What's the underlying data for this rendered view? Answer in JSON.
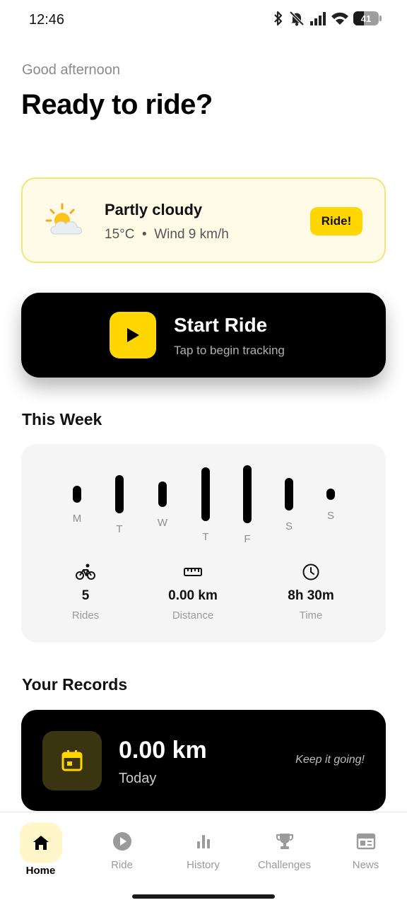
{
  "status_bar": {
    "time": "12:46",
    "battery": "41"
  },
  "header": {
    "greeting": "Good afternoon",
    "headline": "Ready to ride?"
  },
  "weather": {
    "condition": "Partly cloudy",
    "temperature": "15°C",
    "separator": "•",
    "wind": "Wind 9 km/h",
    "cta": "Ride!",
    "icon": "partly-cloudy-icon"
  },
  "start_ride": {
    "title": "Start Ride",
    "subtitle": "Tap to begin tracking",
    "icon": "play-icon"
  },
  "this_week": {
    "title": "This Week",
    "days": [
      {
        "label": "M",
        "level": 0.3
      },
      {
        "label": "T",
        "level": 0.67
      },
      {
        "label": "W",
        "level": 0.43
      },
      {
        "label": "T",
        "level": 0.92
      },
      {
        "label": "F",
        "level": 1.0
      },
      {
        "label": "S",
        "level": 0.57
      },
      {
        "label": "S",
        "level": 0.2
      }
    ],
    "stats": [
      {
        "icon": "bicycle-icon",
        "value": "5",
        "label": "Rides"
      },
      {
        "icon": "ruler-icon",
        "value": "0.00 km",
        "label": "Distance"
      },
      {
        "icon": "clock-icon",
        "value": "8h 30m",
        "label": "Time"
      }
    ]
  },
  "records": {
    "title": "Your Records",
    "value": "0.00 km",
    "label": "Today",
    "note": "Keep it going!",
    "icon": "calendar-icon"
  },
  "nav": {
    "items": [
      {
        "label": "Home",
        "icon": "home-icon",
        "active": true
      },
      {
        "label": "Ride",
        "icon": "play-circle-icon"
      },
      {
        "label": "History",
        "icon": "bar-chart-icon"
      },
      {
        "label": "Challenges",
        "icon": "trophy-icon"
      },
      {
        "label": "News",
        "icon": "newspaper-icon"
      }
    ]
  },
  "colors": {
    "accent": "#FFD600",
    "card_dark": "#000000",
    "muted": "#8E8E8E"
  }
}
